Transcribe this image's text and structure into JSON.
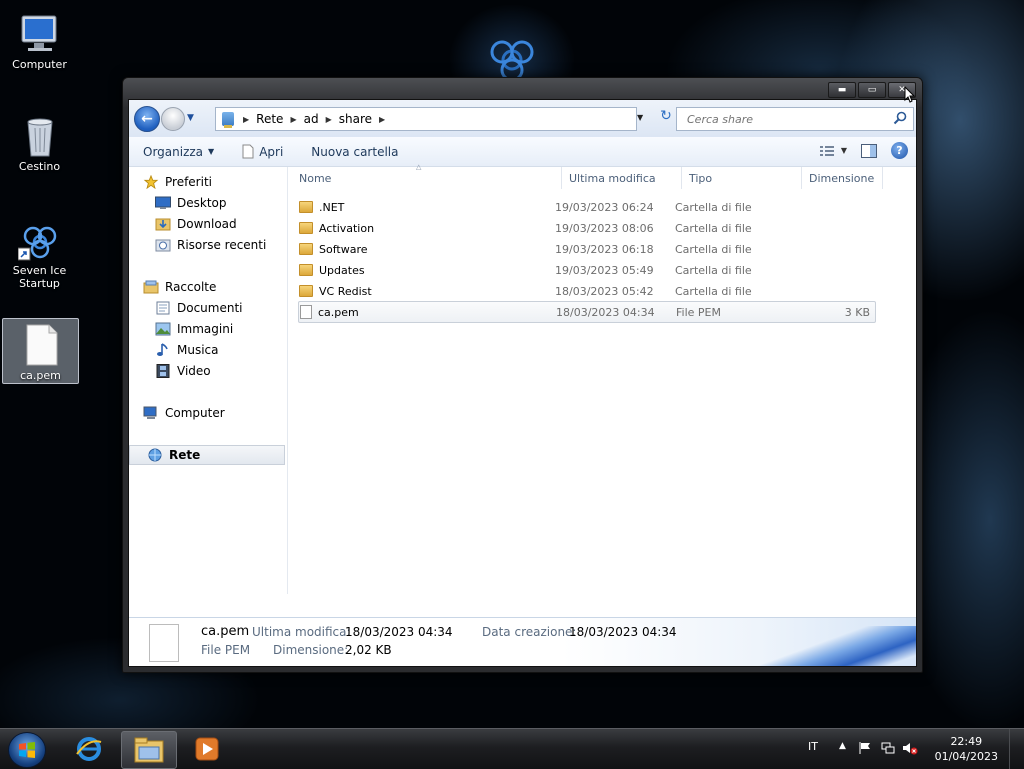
{
  "desktop": {
    "icons": [
      {
        "label": "Computer"
      },
      {
        "label": "Cestino"
      },
      {
        "label": "Seven Ice Startup"
      },
      {
        "label": "ca.pem"
      }
    ]
  },
  "window": {
    "caption_buttons": {
      "minimize": "▬",
      "maximize": "▭",
      "close": "✕"
    },
    "breadcrumb": [
      "Rete",
      "ad",
      "share"
    ],
    "search": {
      "placeholder": "Cerca share"
    },
    "toolbar": {
      "organize": "Organizza",
      "open": "Apri",
      "new_folder": "Nuova cartella"
    },
    "nav": {
      "favorites": "Preferiti",
      "desktop": "Desktop",
      "download": "Download",
      "recent": "Risorse recenti",
      "libraries": "Raccolte",
      "documents": "Documenti",
      "images": "Immagini",
      "music": "Musica",
      "video": "Video",
      "computer": "Computer",
      "network": "Rete"
    },
    "columns": {
      "name": "Nome",
      "modified": "Ultima modifica",
      "type": "Tipo",
      "size": "Dimensione"
    },
    "files": [
      {
        "name": ".NET",
        "modified": "19/03/2023 06:24",
        "type": "Cartella di file",
        "size": "",
        "kind": "folder"
      },
      {
        "name": "Activation",
        "modified": "19/03/2023 08:06",
        "type": "Cartella di file",
        "size": "",
        "kind": "folder"
      },
      {
        "name": "Software",
        "modified": "19/03/2023 06:18",
        "type": "Cartella di file",
        "size": "",
        "kind": "folder"
      },
      {
        "name": "Updates",
        "modified": "19/03/2023 05:49",
        "type": "Cartella di file",
        "size": "",
        "kind": "folder"
      },
      {
        "name": "VC Redist",
        "modified": "18/03/2023 05:42",
        "type": "Cartella di file",
        "size": "",
        "kind": "folder"
      },
      {
        "name": "ca.pem",
        "modified": "18/03/2023 04:34",
        "type": "File PEM",
        "size": "3 KB",
        "kind": "file"
      }
    ],
    "details": {
      "name": "ca.pem",
      "type": "File PEM",
      "modified_label": "Ultima modifica:",
      "modified": "18/03/2023 04:34",
      "size_label": "Dimensione:",
      "size": "2,02 KB",
      "created_label": "Data creazione:",
      "created": "18/03/2023 04:34"
    }
  },
  "taskbar": {
    "language": "IT",
    "time": "22:49",
    "date": "01/04/2023"
  },
  "colors": {
    "accent": "#1f5fbf",
    "taskbar": "#1d1e21"
  }
}
